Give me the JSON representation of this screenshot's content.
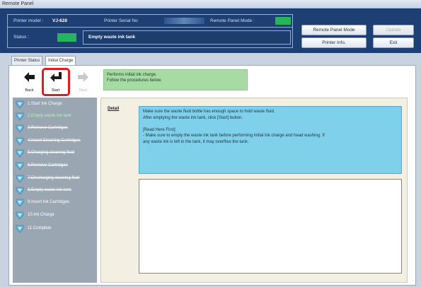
{
  "window": {
    "title": "Remote Panel"
  },
  "header": {
    "printer_model_label": "Printer model :",
    "printer_model_value": "VJ-628",
    "serial_label": "Printer Serial No",
    "remote_mode_label": "Remote Panel Mode :",
    "status_label": "Status :",
    "status_value": "Empty waste ink tank",
    "status_color": "#26b55a",
    "buttons": {
      "remote_panel_mode": "Remote Panel Mode",
      "update": "Update",
      "printer_info": "Printer Info.",
      "exit": "Exit"
    }
  },
  "tabs": [
    {
      "label": "Printer Status",
      "active": false
    },
    {
      "label": "Initial Charge",
      "active": true
    }
  ],
  "nav": {
    "back": "Back",
    "start": "Start",
    "next": "Next"
  },
  "info_message": [
    "Performs initial ink charge.",
    "Follow the procedures below."
  ],
  "steps": [
    {
      "label": "1.Start Ink Charge",
      "state": "pending"
    },
    {
      "label": "2.Empty waste ink tank",
      "state": "current"
    },
    {
      "label": "3.Remove Cartridges",
      "state": "done"
    },
    {
      "label": "4.Insert Cleaning Cartridges",
      "state": "done"
    },
    {
      "label": "5.Charging cleaning fluid",
      "state": "done"
    },
    {
      "label": "6.Remove Cartridges",
      "state": "done"
    },
    {
      "label": "7.Discharging cleaning fluid",
      "state": "done"
    },
    {
      "label": "8.Empty waste ink tank",
      "state": "done"
    },
    {
      "label": "9.Insert Ink Cartridges",
      "state": "pending"
    },
    {
      "label": "10.Ink Charge",
      "state": "pending"
    },
    {
      "label": "11.Complete",
      "state": "pending"
    }
  ],
  "detail": {
    "label": "Detail",
    "text": "Make sure the waste fluid bottle has enough space to hold waste fluid.\nAfter emptying the waste ink tank, click [Start] button.\n\n[Read Here First]\n- Make sure to empty the waste ink tank before performing initial ink charge and head washing. If\nany waste ink is left in the tank, it may overflow the tank."
  }
}
